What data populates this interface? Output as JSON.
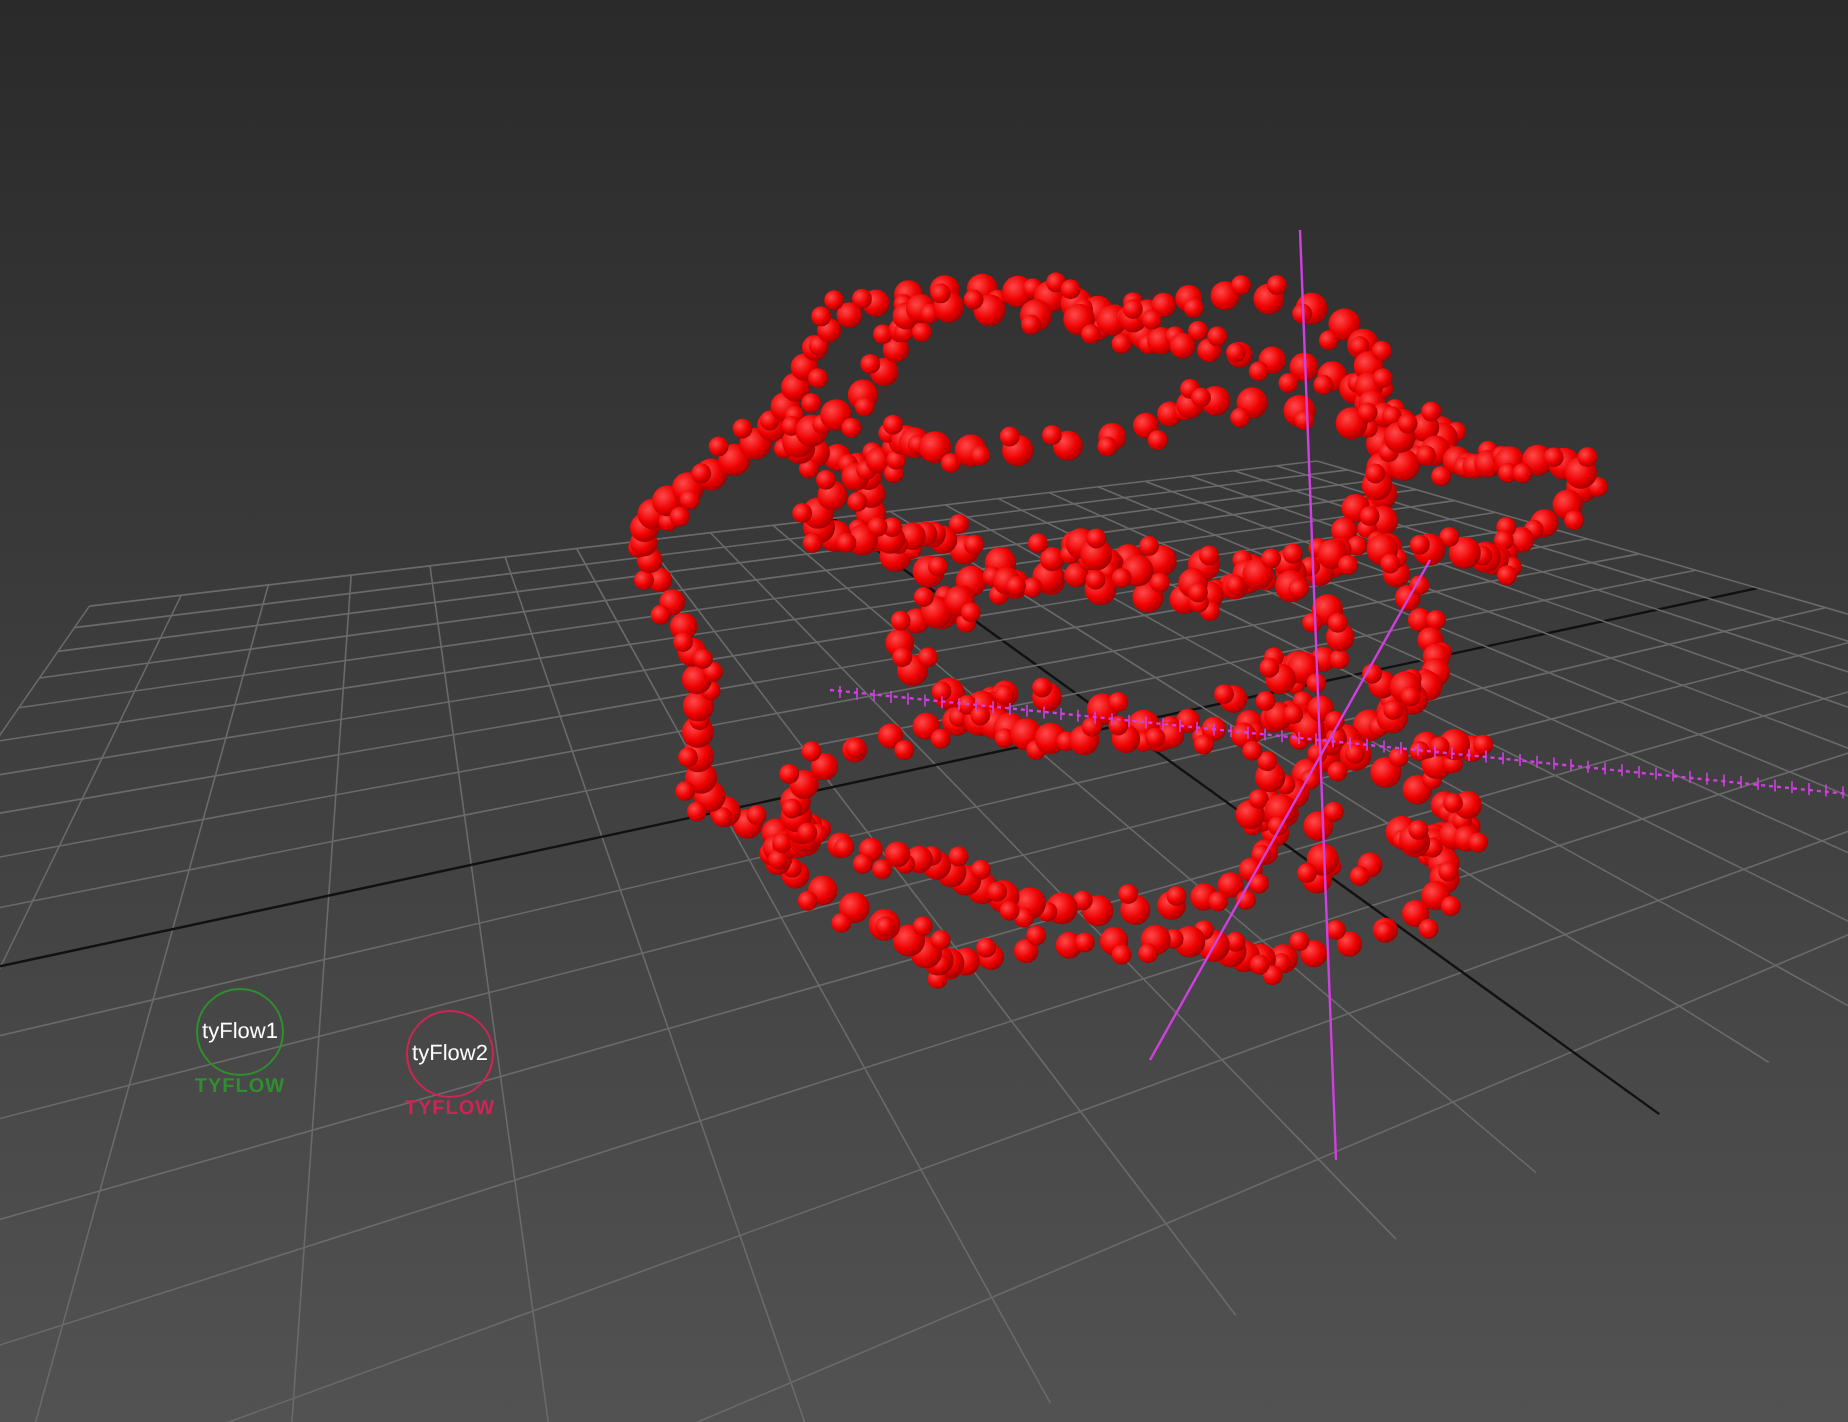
{
  "viewport": {
    "emitters": [
      {
        "name": "tyFlow1",
        "logo": "TYFLOW",
        "color": "#2f8f2f"
      },
      {
        "name": "tyFlow2",
        "logo": "TYFLOW",
        "color": "#d02454"
      }
    ]
  }
}
